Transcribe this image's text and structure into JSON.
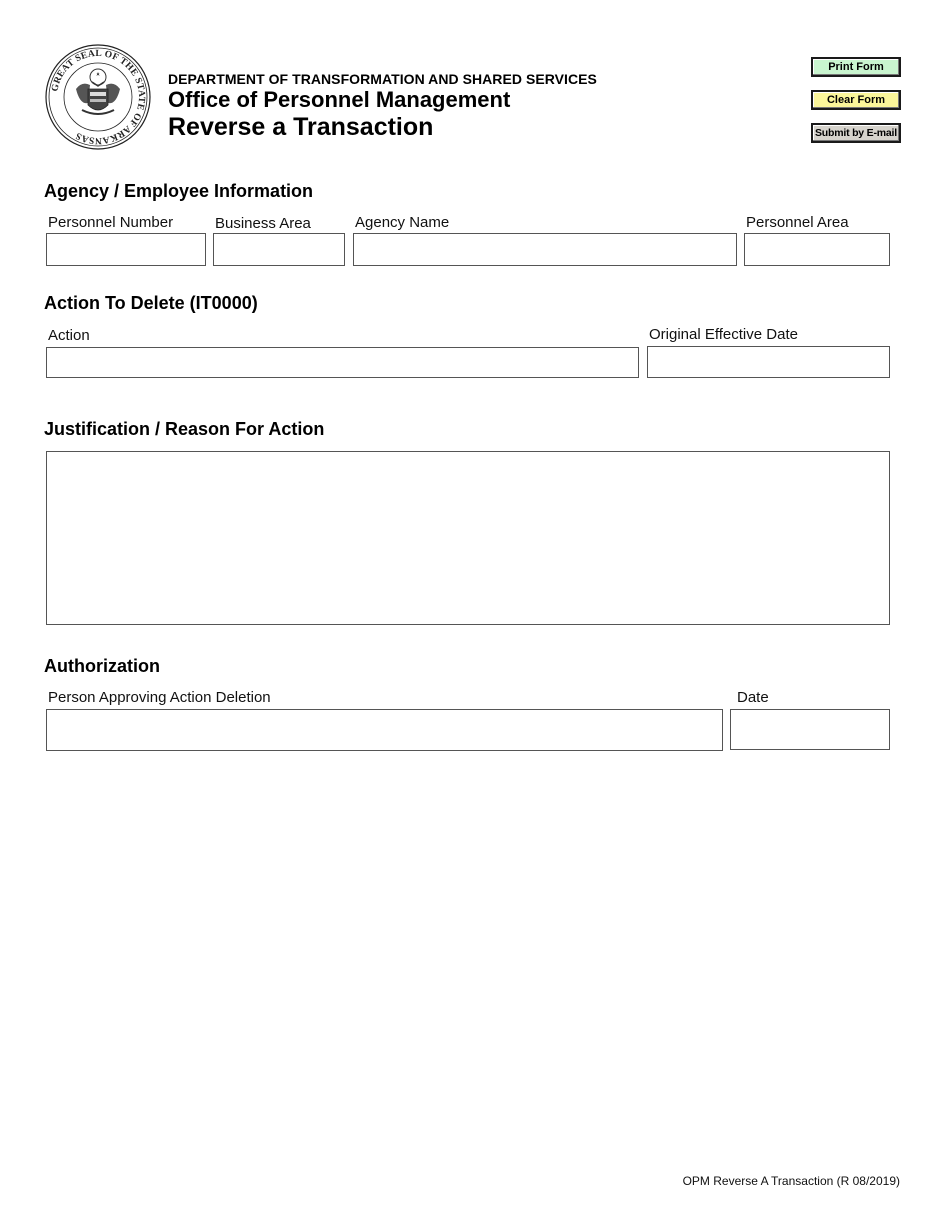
{
  "header": {
    "seal_icon": "great-seal-of-arkansas",
    "seal_text": "GREAT SEAL OF THE STATE OF ARKANSAS",
    "department": "DEPARTMENT OF TRANSFORMATION AND SHARED SERVICES",
    "office": "Office of Personnel Management",
    "title": "Reverse a Transaction"
  },
  "buttons": {
    "print": {
      "label": "Print Form",
      "color": "#c9f5cf"
    },
    "clear": {
      "label": "Clear Form",
      "color": "#fbf69a"
    },
    "email": {
      "label": "Submit by E-mail",
      "color": "#d6d3cc"
    }
  },
  "sections": {
    "agency": {
      "heading": "Agency / Employee Information",
      "fields": {
        "personnel_number": {
          "label": "Personnel Number",
          "value": ""
        },
        "business_area": {
          "label": "Business Area",
          "value": ""
        },
        "agency_name": {
          "label": "Agency Name",
          "value": ""
        },
        "personnel_area": {
          "label": "Personnel Area",
          "value": ""
        }
      }
    },
    "action": {
      "heading": "Action To Delete (IT0000)",
      "fields": {
        "action": {
          "label": "Action",
          "value": ""
        },
        "original_effective_date": {
          "label": "Original Effective Date",
          "value": ""
        }
      }
    },
    "justification": {
      "heading": "Justification / Reason For Action",
      "value": ""
    },
    "authorization": {
      "heading": "Authorization",
      "fields": {
        "approver": {
          "label": "Person Approving Action Deletion",
          "value": ""
        },
        "date": {
          "label": "Date",
          "value": ""
        }
      }
    }
  },
  "footer": {
    "form_id": "OPM Reverse A Transaction (R 08/2019)"
  }
}
